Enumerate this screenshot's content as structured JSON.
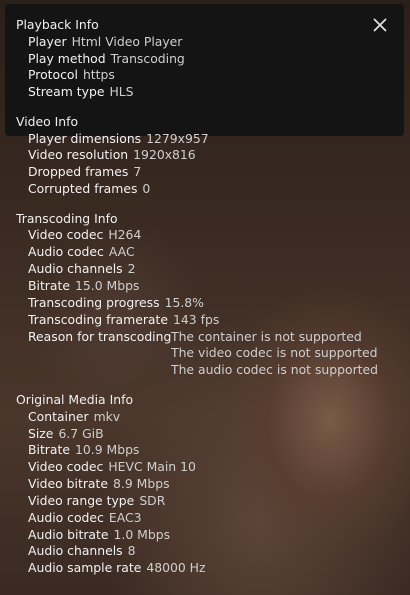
{
  "playback": {
    "title": "Playback Info",
    "rows": [
      {
        "label": "Player",
        "value": "Html Video Player"
      },
      {
        "label": "Play method",
        "value": "Transcoding"
      },
      {
        "label": "Protocol",
        "value": "https"
      },
      {
        "label": "Stream type",
        "value": "HLS"
      }
    ]
  },
  "video": {
    "title": "Video Info",
    "rows": [
      {
        "label": "Player dimensions",
        "value": "1279x957"
      },
      {
        "label": "Video resolution",
        "value": "1920x816"
      },
      {
        "label": "Dropped frames",
        "value": "7"
      },
      {
        "label": "Corrupted frames",
        "value": "0"
      }
    ]
  },
  "transcoding": {
    "title": "Transcoding Info",
    "rows": [
      {
        "label": "Video codec",
        "value": "H264"
      },
      {
        "label": "Audio codec",
        "value": "AAC"
      },
      {
        "label": "Audio channels",
        "value": "2"
      },
      {
        "label": "Bitrate",
        "value": "15.0 Mbps"
      },
      {
        "label": "Transcoding progress",
        "value": "15.8%"
      },
      {
        "label": "Transcoding framerate",
        "value": "143 fps"
      }
    ],
    "reason_label": "Reason for transcoding",
    "reasons": [
      "The container is not supported",
      "The video codec is not supported",
      "The audio codec is not supported"
    ]
  },
  "original": {
    "title": "Original Media Info",
    "rows": [
      {
        "label": "Container",
        "value": "mkv"
      },
      {
        "label": "Size",
        "value": "6.7 GiB"
      },
      {
        "label": "Bitrate",
        "value": "10.9 Mbps"
      },
      {
        "label": "Video codec",
        "value": "HEVC Main 10"
      },
      {
        "label": "Video bitrate",
        "value": "8.9 Mbps"
      },
      {
        "label": "Video range type",
        "value": "SDR"
      },
      {
        "label": "Audio codec",
        "value": "EAC3"
      },
      {
        "label": "Audio bitrate",
        "value": "1.0 Mbps"
      },
      {
        "label": "Audio channels",
        "value": "8"
      },
      {
        "label": "Audio sample rate",
        "value": "48000 Hz"
      }
    ]
  },
  "icons": {
    "close": "close-icon"
  },
  "colors": {
    "panel": "#141414",
    "text": "#e6e6e6"
  }
}
